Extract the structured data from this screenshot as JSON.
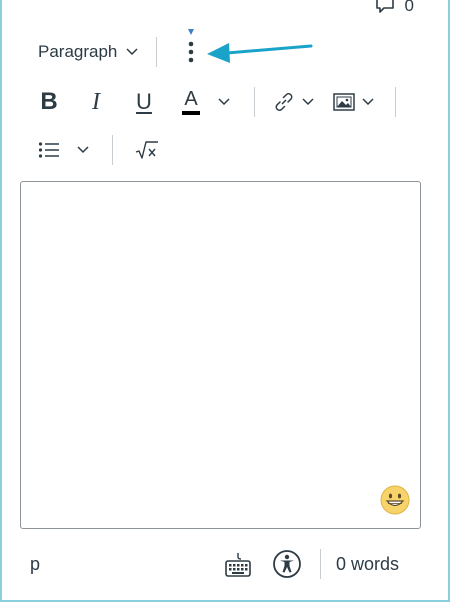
{
  "header": {
    "comment_count": "0",
    "comment_icon": "comment-icon"
  },
  "toolbar": {
    "block_format": "Paragraph",
    "more_icon": "more-vertical-icon",
    "bold_label": "B",
    "italic_label": "I",
    "underline_label": "U",
    "text_color_label": "A",
    "text_color_value": "#000000",
    "link_icon": "link-icon",
    "image_icon": "image-icon",
    "list_icon": "bullet-list-icon",
    "equation_icon": "equation-icon"
  },
  "editor": {
    "content": "",
    "emoji_icon": "emoji-icon"
  },
  "statusbar": {
    "path": "p",
    "keyboard_icon": "keyboard-icon",
    "accessibility_icon": "accessibility-icon",
    "word_count": "0 words"
  },
  "annotation": {
    "arrow_color": "#1aa3c8",
    "accent_color": "#89cfe0"
  }
}
